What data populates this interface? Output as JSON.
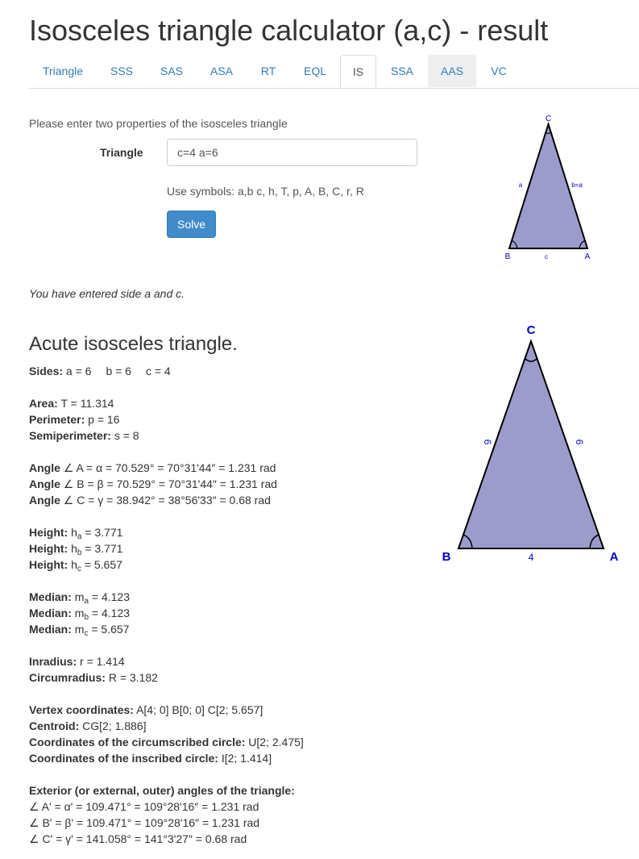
{
  "page": {
    "title": "Isosceles triangle calculator (a,c) - result"
  },
  "tabs": [
    {
      "label": "Triangle"
    },
    {
      "label": "SSS"
    },
    {
      "label": "SAS"
    },
    {
      "label": "ASA"
    },
    {
      "label": "RT"
    },
    {
      "label": "EQL"
    },
    {
      "label": "IS"
    },
    {
      "label": "SSA"
    },
    {
      "label": "AAS"
    },
    {
      "label": "VC"
    }
  ],
  "form": {
    "hint": "Please enter two properties of the isosceles triangle",
    "field_label": "Triangle",
    "input_value": "c=4 a=6",
    "symbols_help": "Use symbols: a,b c, h, T, p, A, B, C, r, R",
    "solve_label": "Solve"
  },
  "entered_text": "You have entered side a and c.",
  "result_title": "Acute isosceles triangle.",
  "results": {
    "sides": {
      "label": "Sides:",
      "a": "a = 6",
      "b": "b = 6",
      "c": "c = 4"
    },
    "area": {
      "label": "Area:",
      "value": "T = 11.314"
    },
    "perimeter": {
      "label": "Perimeter:",
      "value": "p = 16"
    },
    "semiperimeter": {
      "label": "Semiperimeter:",
      "value": "s = 8"
    },
    "angles": [
      {
        "label": "Angle",
        "value": "∠ A = α = 70.529° = 70°31'44″ = 1.231 rad"
      },
      {
        "label": "Angle",
        "value": "∠ B = β = 70.529° = 70°31'44″ = 1.231 rad"
      },
      {
        "label": "Angle",
        "value": "∠ C = γ = 38.942° = 38°56'33″ = 0.68 rad"
      }
    ],
    "heights": [
      {
        "label": "Height:",
        "sym": "h",
        "sub": "a",
        "value": " = 3.771"
      },
      {
        "label": "Height:",
        "sym": "h",
        "sub": "b",
        "value": " = 3.771"
      },
      {
        "label": "Height:",
        "sym": "h",
        "sub": "c",
        "value": " = 5.657"
      }
    ],
    "medians": [
      {
        "label": "Median:",
        "sym": "m",
        "sub": "a",
        "value": " = 4.123"
      },
      {
        "label": "Median:",
        "sym": "m",
        "sub": "b",
        "value": " = 4.123"
      },
      {
        "label": "Median:",
        "sym": "m",
        "sub": "c",
        "value": " = 5.657"
      }
    ],
    "inradius": {
      "label": "Inradius:",
      "value": "r = 1.414"
    },
    "circumradius": {
      "label": "Circumradius:",
      "value": "R = 3.182"
    },
    "vertex_coordinates": {
      "label": "Vertex coordinates:",
      "value": "A[4; 0] B[0; 0] C[2; 5.657]"
    },
    "centroid": {
      "label": "Centroid:",
      "value": "CG[2; 1.886]"
    },
    "circumcircle": {
      "label": "Coordinates of the circumscribed circle:",
      "value": "U[2; 2.475]"
    },
    "incircle": {
      "label": "Coordinates of the inscribed circle:",
      "value": "I[2; 1.414]"
    },
    "exterior_title": "Exterior (or external, outer) angles of the triangle:",
    "exterior": [
      "∠ A' = α' = 109.471° = 109°28'16″ = 1.231 rad",
      "∠ B' = β' = 109.471° = 109°28'16″ = 1.231 rad",
      "∠ C' = γ' = 141.058° = 141°3'27″ = 0.68 rad"
    ]
  },
  "small_diagram": {
    "fill": "#9b9bcc",
    "label_color": "#0000cc",
    "labels": {
      "C": "C",
      "B": "B",
      "A": "A",
      "a": "a",
      "b": "b=a",
      "c": "c"
    }
  },
  "large_diagram": {
    "fill": "#9b9bcc",
    "label_color": "#0000cc",
    "labels": {
      "C": "C",
      "B": "B",
      "A": "A",
      "side_a": "6",
      "side_b": "6",
      "side_c": "4"
    }
  }
}
